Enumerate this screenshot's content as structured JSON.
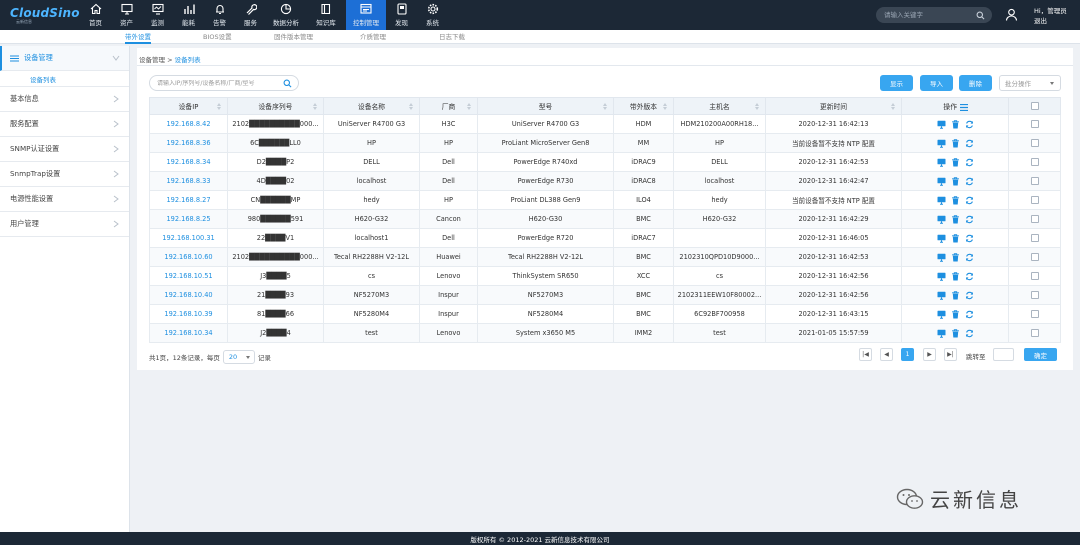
{
  "brand": {
    "name": "CloudSino",
    "tagline": "云新信息"
  },
  "nav": [
    {
      "label": "首页",
      "icon": "home-icon"
    },
    {
      "label": "资产",
      "icon": "monitor-icon"
    },
    {
      "label": "监测",
      "icon": "monitor-screen-icon"
    },
    {
      "label": "能耗",
      "icon": "bar-chart-icon"
    },
    {
      "label": "告警",
      "icon": "bell-icon"
    },
    {
      "label": "服务",
      "icon": "wrench-icon"
    },
    {
      "label": "数据分析",
      "icon": "pie-chart-icon"
    },
    {
      "label": "知识库",
      "icon": "book-icon"
    },
    {
      "label": "控制管理",
      "icon": "control-panel-icon",
      "active": true
    },
    {
      "label": "发现",
      "icon": "discover-icon"
    },
    {
      "label": "系统",
      "icon": "gear-icon"
    }
  ],
  "search": {
    "placeholder": "请输入关键字"
  },
  "user": {
    "greeting": "Hi，管理员",
    "logout": "退出"
  },
  "subtabs": [
    "带外设置",
    "BIOS设置",
    "固件版本管理",
    "介质管理",
    "日志下载"
  ],
  "sidebar": {
    "items": [
      {
        "label": "设备管理",
        "open": true
      },
      {
        "label": "基本信息"
      },
      {
        "label": "服务配置"
      },
      {
        "label": "SNMP认证设置"
      },
      {
        "label": "SnmpTrap设置"
      },
      {
        "label": "电源性能设置"
      },
      {
        "label": "用户管理"
      }
    ],
    "sub_item": "设备列表"
  },
  "breadcrumb": {
    "parent": "设备管理",
    "sep": " > ",
    "current": "设备列表"
  },
  "toolbar": {
    "search_placeholder": "请输入IP/序列号/设备名称/厂商/型号",
    "display": "显示",
    "import": "导入",
    "delete": "删除",
    "batch": "批分操作"
  },
  "table": {
    "headers": [
      "设备IP",
      "设备序列号",
      "设备名称",
      "厂商",
      "型号",
      "带外版本",
      "主机名",
      "更新时间",
      "操作"
    ],
    "rows": [
      [
        "192.168.8.42",
        "2102██████████000...",
        "UniServer R4700 G3",
        "H3C",
        "UniServer R4700 G3",
        "HDM",
        "HDM210200A00RH18...",
        "2020-12-31 16:42:13"
      ],
      [
        "192.168.8.36",
        "6C██████LL0",
        "HP",
        "HP",
        "ProLiant MicroServer Gen8",
        "MM",
        "HP",
        "当前设备暂不支持 NTP 配置"
      ],
      [
        "192.168.8.34",
        "D2████P2",
        "DELL",
        "Dell",
        "PowerEdge R740xd",
        "iDRAC9",
        "DELL",
        "2020-12-31 16:42:53"
      ],
      [
        "192.168.8.33",
        "4D████02",
        "localhost",
        "Dell",
        "PowerEdge R730",
        "iDRAC8",
        "localhost",
        "2020-12-31 16:42:47"
      ],
      [
        "192.168.8.27",
        "CN██████MP",
        "hedy",
        "HP",
        "ProLiant DL388 Gen9",
        "ILO4",
        "hedy",
        "当前设备暂不支持 NTP 配置"
      ],
      [
        "192.168.8.25",
        "980██████591",
        "H620-G32",
        "Cancon",
        "H620-G30",
        "BMC",
        "H620-G32",
        "2020-12-31 16:42:29"
      ],
      [
        "192.168.100.31",
        "22████V1",
        "localhost1",
        "Dell",
        "PowerEdge R720",
        "iDRAC7",
        "",
        "2020-12-31 16:46:05"
      ],
      [
        "192.168.10.60",
        "2102██████████000...",
        "Tecal RH2288H V2-12L",
        "Huawei",
        "Tecal RH2288H V2-12L",
        "BMC",
        "2102310QPD10D9000...",
        "2020-12-31 16:42:53"
      ],
      [
        "192.168.10.51",
        "J3████5",
        "cs",
        "Lenovo",
        "ThinkSystem SR650",
        "XCC",
        "cs",
        "2020-12-31 16:42:56"
      ],
      [
        "192.168.10.40",
        "21████93",
        "NF5270M3",
        "Inspur",
        "NF5270M3",
        "BMC",
        "2102311EEW10F80002...",
        "2020-12-31 16:42:56"
      ],
      [
        "192.168.10.39",
        "81████66",
        "NF5280M4",
        "Inspur",
        "NF5280M4",
        "BMC",
        "6C92BF700958",
        "2020-12-31 16:43:15"
      ],
      [
        "192.168.10.34",
        "J2████4",
        "test",
        "Lenovo",
        "System x3650 M5",
        "IMM2",
        "test",
        "2021-01-05 15:57:59"
      ]
    ]
  },
  "pagination": {
    "summary": "共1页，12条记录，每页",
    "page_size": "20",
    "unit": "记录",
    "first": "|◀",
    "prev": "◀",
    "current": "1",
    "next": "▶",
    "last": "▶|",
    "goto_label": "跳转至",
    "confirm": "确定"
  },
  "footer": "版权所有 © 2012-2021  云新信息技术有限公司",
  "watermark": "云新信息",
  "colors": {
    "accent": "#1d8fe0",
    "nav_bg": "#1c2836",
    "button": "#38a6f0"
  }
}
